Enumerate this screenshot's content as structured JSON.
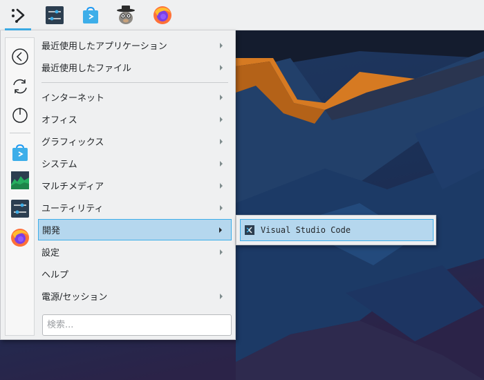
{
  "panel": {
    "items": [
      {
        "name": "application-launcher",
        "active": true
      },
      {
        "name": "system-settings"
      },
      {
        "name": "discover"
      },
      {
        "name": "user-app"
      },
      {
        "name": "firefox"
      }
    ]
  },
  "sidebar": {
    "buttons": [
      {
        "name": "back-icon"
      },
      {
        "name": "refresh-icon"
      },
      {
        "name": "power-icon"
      },
      {
        "name": "discover-icon"
      },
      {
        "name": "system-monitor-icon"
      },
      {
        "name": "system-settings-icon"
      },
      {
        "name": "firefox-icon"
      }
    ]
  },
  "menu": {
    "items": [
      {
        "label": "最近使用したアプリケーション",
        "submenu": true
      },
      {
        "label": "最近使用したファイル",
        "submenu": true
      },
      {
        "label": "インターネット",
        "submenu": true
      },
      {
        "label": "オフィス",
        "submenu": true
      },
      {
        "label": "グラフィックス",
        "submenu": true
      },
      {
        "label": "システム",
        "submenu": true
      },
      {
        "label": "マルチメディア",
        "submenu": true
      },
      {
        "label": "ユーティリティ",
        "submenu": true
      },
      {
        "label": "開発",
        "submenu": true,
        "selected": true
      },
      {
        "label": "設定",
        "submenu": true
      },
      {
        "label": "ヘルプ",
        "submenu": false
      },
      {
        "label": "電源/セッション",
        "submenu": true
      }
    ],
    "search_placeholder": "検索..."
  },
  "submenu": {
    "items": [
      {
        "label": "Visual Studio Code",
        "icon": "vscode-icon"
      }
    ]
  },
  "colors": {
    "accent": "#3daee9",
    "selection": "#b5d7ee",
    "panel_bg": "#eff0f1",
    "text": "#232629"
  }
}
